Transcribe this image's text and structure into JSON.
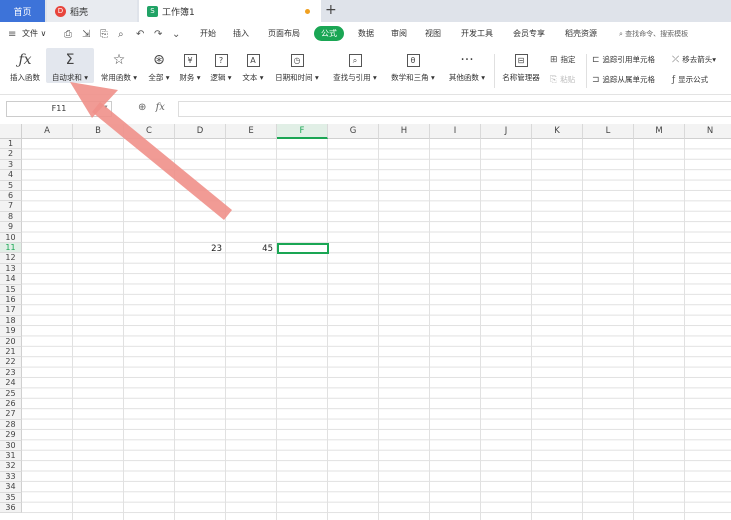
{
  "tabs": {
    "home": "首页",
    "daoke": "稻壳",
    "workbook": "工作簿1",
    "new_tab": "+"
  },
  "menu": {
    "file": "文件",
    "items": [
      "开始",
      "插入",
      "页面布局",
      "公式",
      "数据",
      "审阅",
      "视图",
      "开发工具",
      "会员专享",
      "稻壳资源"
    ],
    "active": "公式",
    "search": "查找命令、搜索模板"
  },
  "ribbon": {
    "insert_function": "插入函数",
    "autosum": "自动求和",
    "common_functions": "常用函数",
    "all": "全部",
    "finance": "财务",
    "logic": "逻辑",
    "text": "文本",
    "datetime": "日期和时间",
    "lookup": "查找与引用",
    "math": "数学和三角",
    "other": "其他函数",
    "name_manager": "名称管理器",
    "specify": "指定",
    "paste": "粘贴",
    "trace_precedents": "追踪引用单元格",
    "trace_dependents": "追踪从属单元格",
    "remove_arrows": "移去箭头",
    "show_formulas": "显示公式"
  },
  "formula_bar": {
    "name_box": "F11",
    "fx": "fx",
    "value": ""
  },
  "sheet": {
    "columns": [
      "A",
      "B",
      "C",
      "D",
      "E",
      "F",
      "G",
      "H",
      "I",
      "J",
      "K",
      "L",
      "M",
      "N"
    ],
    "rows": [
      "1",
      "2",
      "3",
      "4",
      "5",
      "6",
      "7",
      "8",
      "9",
      "10",
      "11",
      "12",
      "13",
      "14",
      "15",
      "16",
      "17",
      "18",
      "19",
      "20",
      "21",
      "22",
      "23",
      "24",
      "25",
      "26",
      "27",
      "28",
      "29",
      "30",
      "31",
      "32",
      "33",
      "34",
      "35",
      "36"
    ],
    "active_cell": "F11",
    "cells": [
      {
        "ref": "D11",
        "value": "23"
      },
      {
        "ref": "E11",
        "value": "45"
      }
    ]
  },
  "colors": {
    "accent": "#1aa654",
    "home_tab": "#3d73d9",
    "arrow": "#f0908a"
  }
}
